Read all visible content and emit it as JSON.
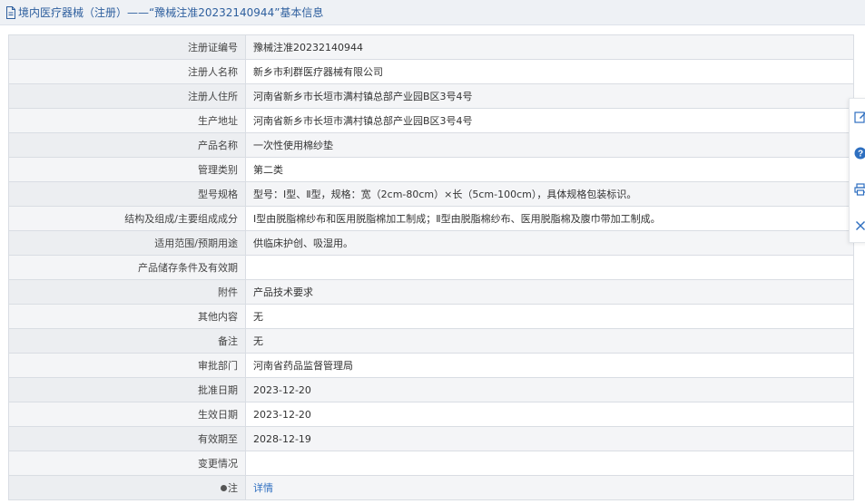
{
  "header": {
    "title": "境内医疗器械（注册）——“豫械注准20232140944”基本信息"
  },
  "rows": [
    {
      "label": "注册证编号",
      "value": "豫械注准20232140944"
    },
    {
      "label": "注册人名称",
      "value": "新乡市利群医疗器械有限公司"
    },
    {
      "label": "注册人住所",
      "value": "河南省新乡市长垣市满村镇总部产业园B区3号4号"
    },
    {
      "label": "生产地址",
      "value": "河南省新乡市长垣市满村镇总部产业园B区3号4号"
    },
    {
      "label": "产品名称",
      "value": "一次性使用棉纱垫"
    },
    {
      "label": "管理类别",
      "value": "第二类"
    },
    {
      "label": "型号规格",
      "value": "型号：Ⅰ型、Ⅱ型，规格：宽（2cm-80cm）×长（5cm-100cm），具体规格包装标识。"
    },
    {
      "label": "结构及组成/主要组成成分",
      "value": "Ⅰ型由脱脂棉纱布和医用脱脂棉加工制成；Ⅱ型由脱脂棉纱布、医用脱脂棉及腹巾带加工制成。"
    },
    {
      "label": "适用范围/预期用途",
      "value": "供临床护创、吸湿用。"
    },
    {
      "label": "产品储存条件及有效期",
      "value": ""
    },
    {
      "label": "附件",
      "value": "产品技术要求"
    },
    {
      "label": "其他内容",
      "value": "无"
    },
    {
      "label": "备注",
      "value": "无"
    },
    {
      "label": "审批部门",
      "value": "河南省药品监督管理局"
    },
    {
      "label": "批准日期",
      "value": "2023-12-20"
    },
    {
      "label": "生效日期",
      "value": "2023-12-20"
    },
    {
      "label": "有效期至",
      "value": "2028-12-19"
    },
    {
      "label": "变更情况",
      "value": ""
    }
  ],
  "note_row": {
    "label": "注",
    "link": "详情"
  },
  "colors": {
    "accent": "#2e5f9e",
    "link": "#2e6fc0",
    "border": "#d9dde3",
    "alt_bg": "#f4f5f7"
  },
  "side_tools": [
    "edit-icon",
    "help-icon",
    "print-icon",
    "close-icon"
  ]
}
